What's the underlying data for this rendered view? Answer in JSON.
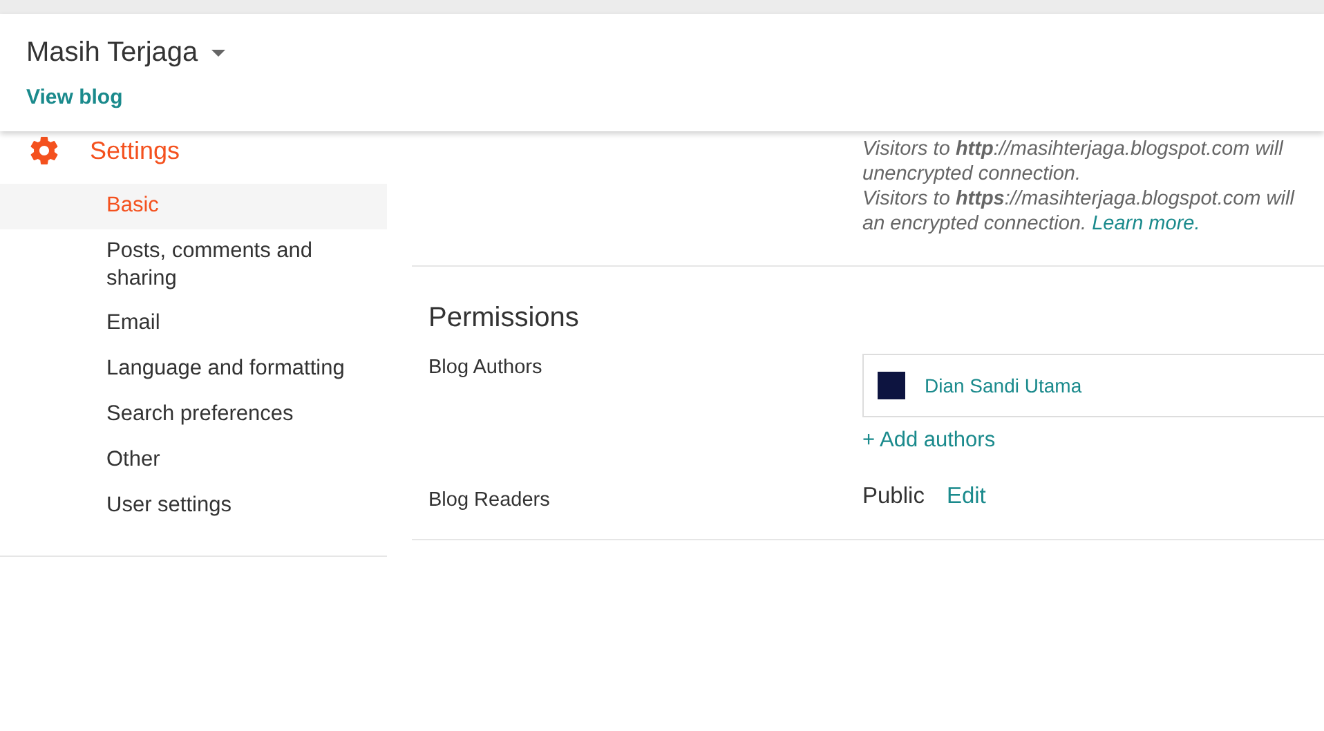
{
  "header": {
    "blog_title": "Masih Terjaga",
    "view_blog": "View blog"
  },
  "sidebar": {
    "section": "Settings",
    "items": [
      {
        "label": "Basic",
        "selected": true
      },
      {
        "label": "Posts, comments and sharing",
        "selected": false
      },
      {
        "label": "Email",
        "selected": false
      },
      {
        "label": "Language and formatting",
        "selected": false
      },
      {
        "label": "Search preferences",
        "selected": false
      },
      {
        "label": "Other",
        "selected": false
      },
      {
        "label": "User settings",
        "selected": false
      }
    ]
  },
  "https_note": [
    {
      "text": "Visitors to **http**://masihterjaga.blogspot.com will"
    },
    {
      "text": "unencrypted connection."
    },
    {
      "text": "Visitors to **https**://masihterjaga.blogspot.com will"
    },
    {
      "text": "an encrypted connection.",
      "link": "Learn more."
    }
  ],
  "permissions": {
    "title": "Permissions",
    "authors_label": "Blog Authors",
    "authors": [
      {
        "name": "Dian Sandi Utama"
      }
    ],
    "add_authors": "+ Add authors",
    "readers_label": "Blog Readers",
    "readers_value": "Public",
    "readers_edit": "Edit"
  }
}
